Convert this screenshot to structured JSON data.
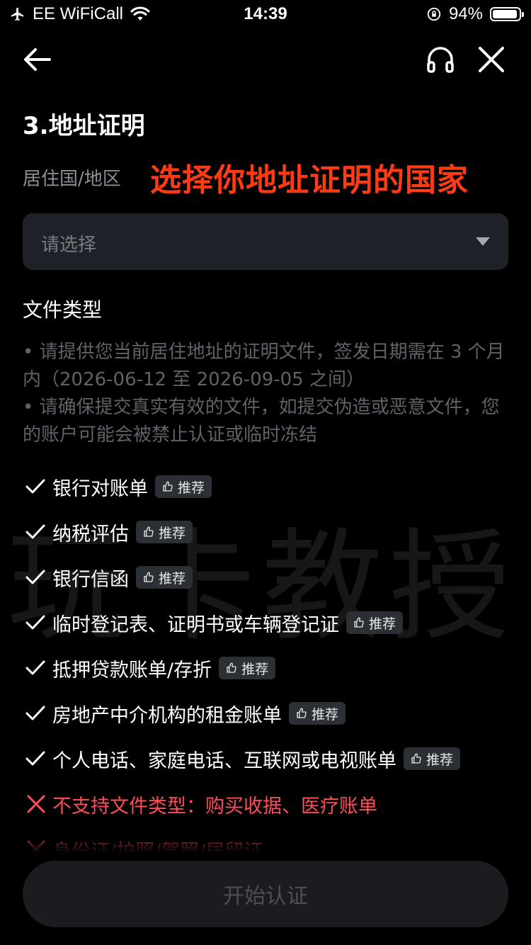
{
  "status_bar": {
    "carrier": "EE WiFiCall",
    "time": "14:39",
    "battery_percent": "94%",
    "battery_level": 0.94
  },
  "header": {
    "back_icon": "back-arrow-icon",
    "support_icon": "headset-icon",
    "close_icon": "close-icon"
  },
  "page": {
    "title": "3.地址证明",
    "country_label": "居住国/地区",
    "annotation": "选择你地址证明的国家",
    "select_placeholder": "请选择",
    "doc_type_title": "文件类型",
    "notes": [
      "• 请提供您当前居住地址的证明文件，签发日期需在 3 个月内（2026-06-12 至 2026-09-05 之间）",
      "• 请确保提交真实有效的文件，如提交伪造或恶意文件，您的账户可能会被禁止认证或临时冻结"
    ],
    "badge_label": "推荐",
    "accepted": [
      "银行对账单",
      "纳税评估",
      "银行信函",
      "临时登记表、证明书或车辆登记证",
      "抵押贷款账单/存折",
      "房地产中介机构的租金账单",
      "个人电话、家庭电话、互联网或电视账单"
    ],
    "rejected": [
      "不支持文件类型：购买收据、医疗账单",
      "身份证/护照/驾照/居留证"
    ],
    "watermark": "玩卡教授",
    "start_button": "开始认证"
  },
  "colors": {
    "accent_red": "#ff3b14",
    "reject_red": "#ff4d57",
    "muted": "#5f6268"
  }
}
